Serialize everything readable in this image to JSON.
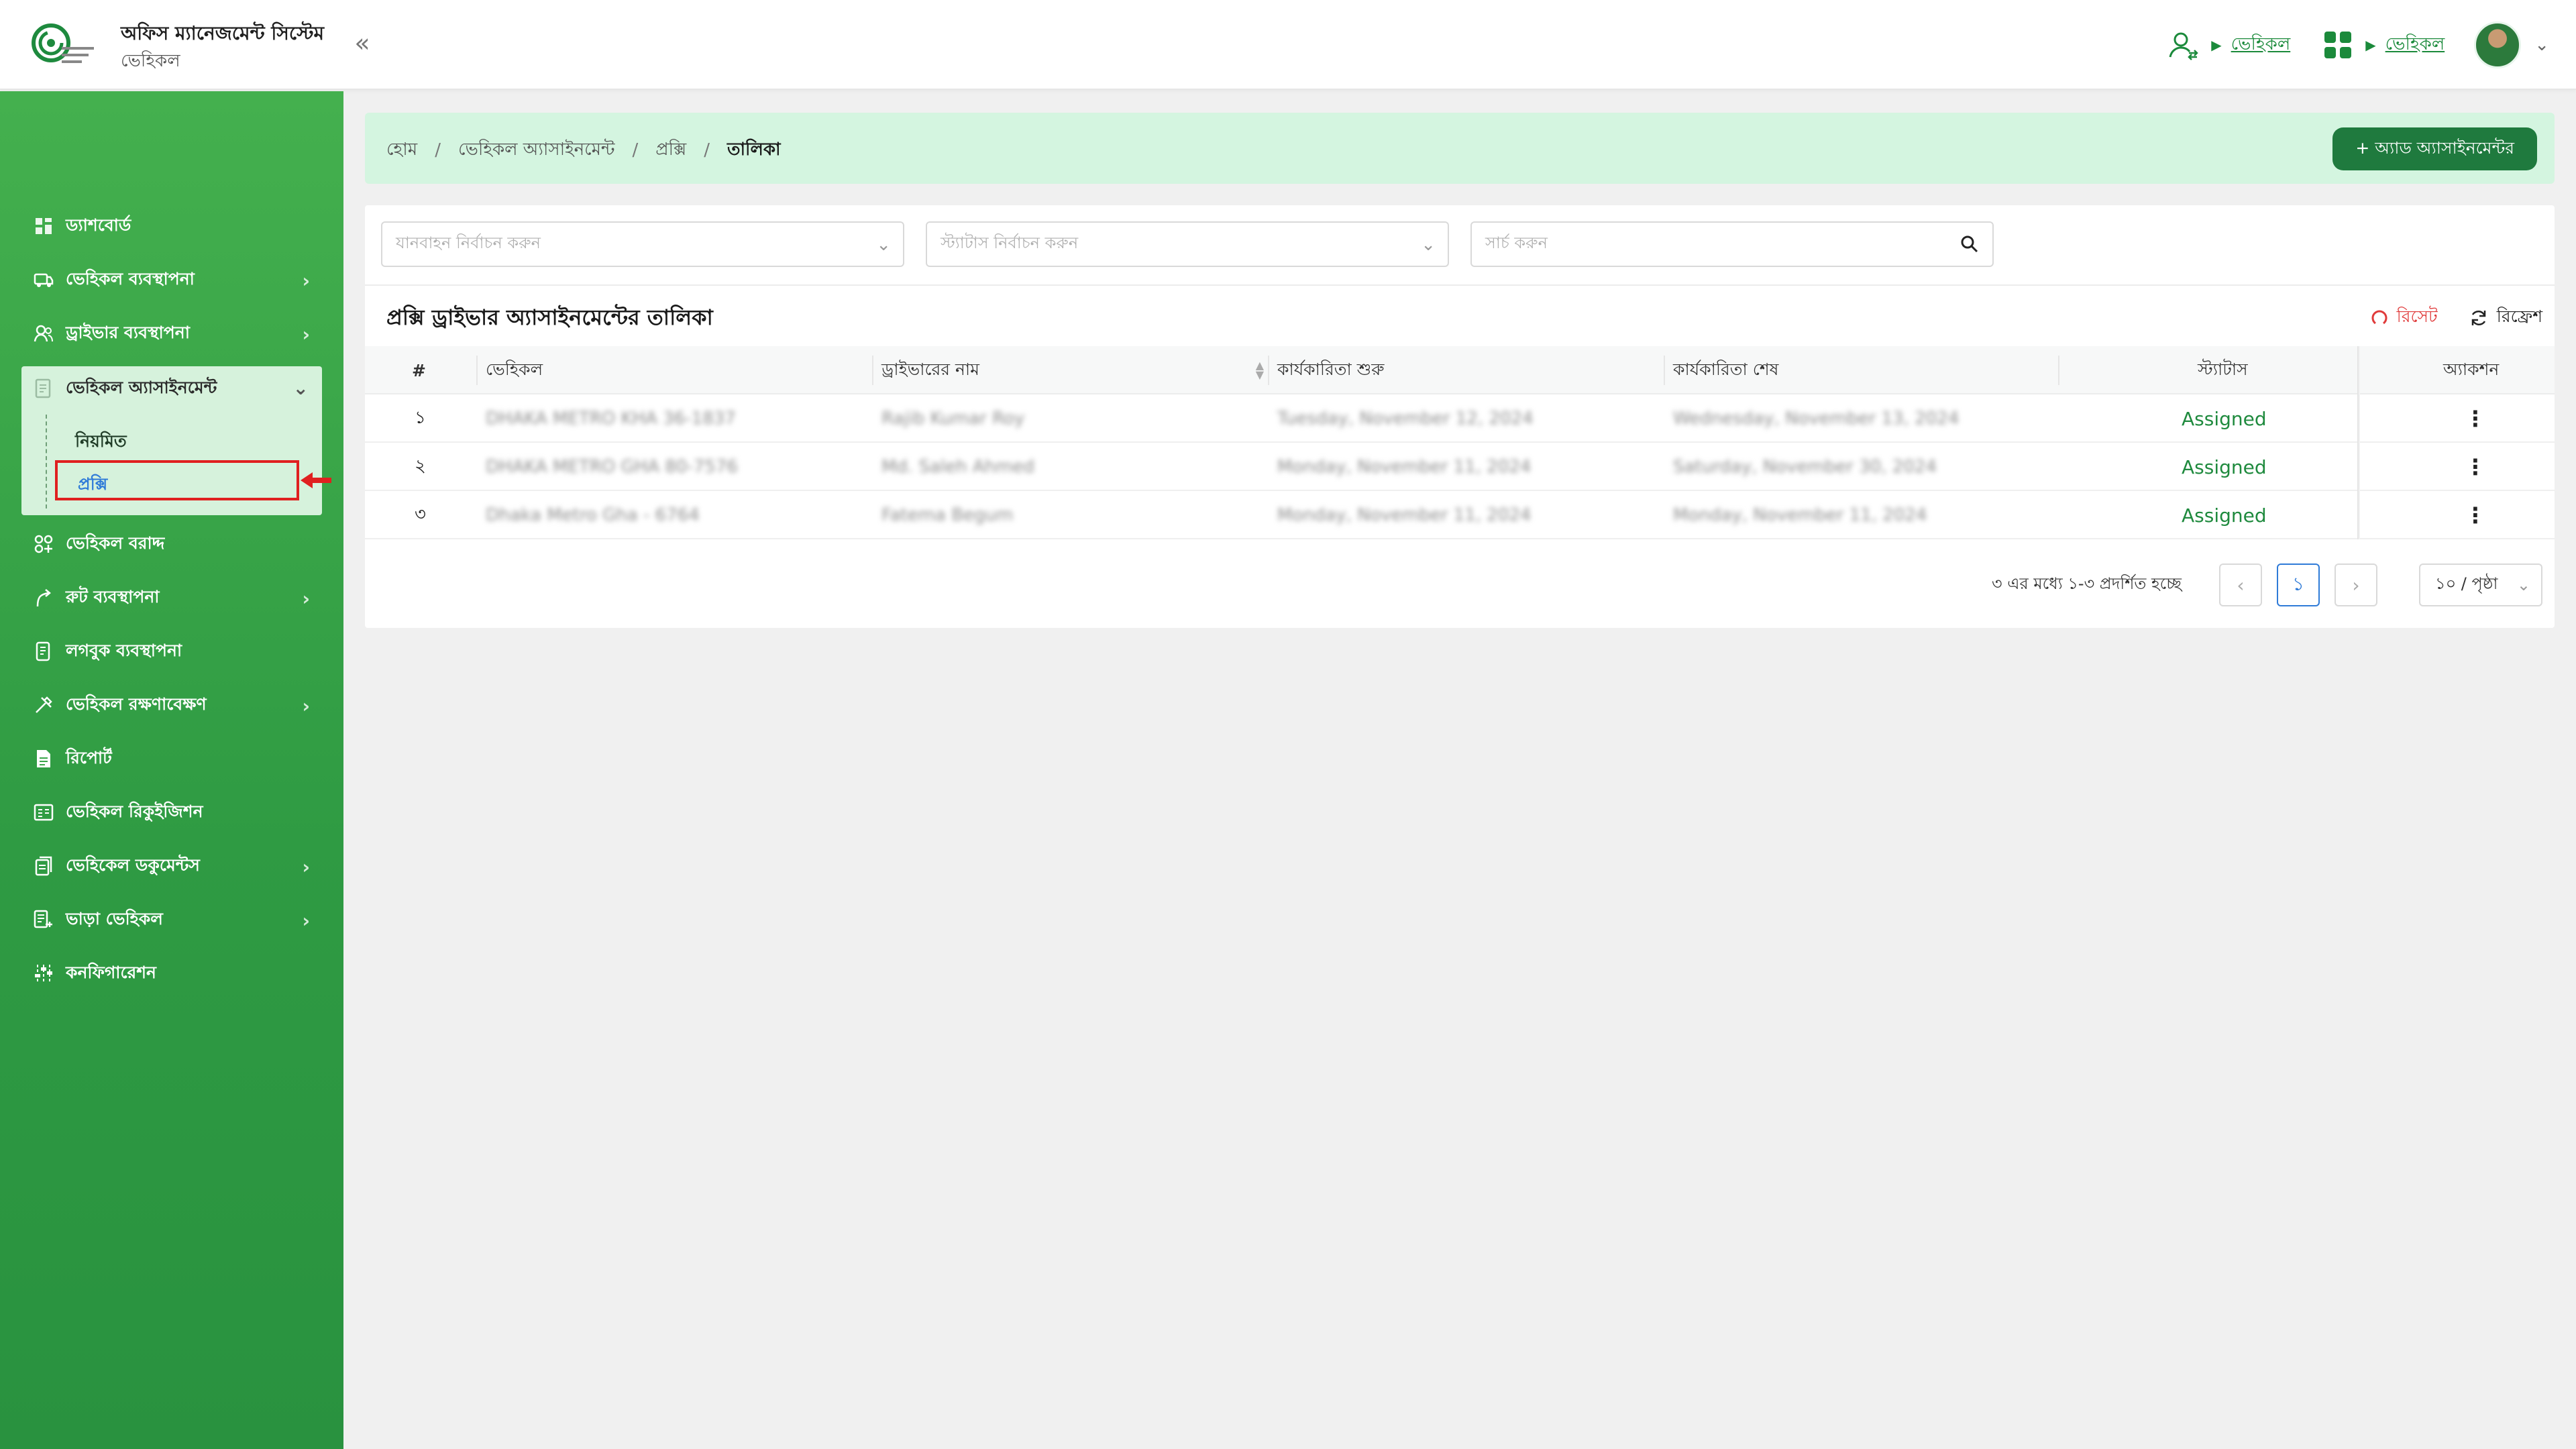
{
  "app": {
    "title": "অফিস ম্যানেজমেন্ট সিস্টেম",
    "subtitle": "ভেহিকল"
  },
  "header": {
    "link1": "ভেহিকল",
    "link2": "ভেহিকল",
    "collapse_icon": "«"
  },
  "sidebar": {
    "items": [
      {
        "label": "ড্যাশবোর্ড",
        "icon": "dashboard-icon"
      },
      {
        "label": "ভেহিকল ব্যবস্থাপনা",
        "icon": "car-icon"
      },
      {
        "label": "ড্রাইভার ব্যবস্থাপনা",
        "icon": "users-icon"
      },
      {
        "label": "ভেহিকল অ্যাসাইনমেন্ট",
        "icon": "document-icon"
      },
      {
        "label": "ভেহিকল বরাদ্দ",
        "icon": "grid-plus-icon"
      },
      {
        "label": "রুট ব্যবস্থাপনা",
        "icon": "route-icon"
      },
      {
        "label": "লগবুক ব্যবস্থাপনা",
        "icon": "logbook-icon"
      },
      {
        "label": "ভেহিকল রক্ষণাবেক্ষণ",
        "icon": "tools-icon"
      },
      {
        "label": "রিপোর্ট",
        "icon": "report-icon"
      },
      {
        "label": "ভেহিকল রিকুইজিশন",
        "icon": "requisition-icon"
      },
      {
        "label": "ভেহিকেল ডকুমেন্টস",
        "icon": "documents-icon"
      },
      {
        "label": "ভাড়া ভেহিকল",
        "icon": "rent-icon"
      },
      {
        "label": "কনফিগারেশন",
        "icon": "sliders-icon"
      }
    ],
    "assignment_sub": {
      "regular": "নিয়মিত",
      "proxy": "প্রক্সি"
    }
  },
  "breadcrumb": {
    "items": [
      "হোম",
      "ভেহিকল অ্যাসাইনমেন্ট",
      "প্রক্সি",
      "তালিকা"
    ],
    "separator": "/"
  },
  "add_button": "+ অ্যাড অ্যাসাইনমেন্টর",
  "filters": {
    "vehicle_placeholder": "যানবাহন নির্বাচন করুন",
    "status_placeholder": "স্ট্যাটাস নির্বাচন করুন",
    "search_placeholder": "সার্চ করুন"
  },
  "table": {
    "title": "প্রক্সি ড্রাইভার অ্যাসাইনমেন্টের তালিকা",
    "reset": "রিসেট",
    "refresh": "রিফ্রেশ",
    "headers": [
      "#",
      "ভেহিকল",
      "ড্রাইভারের নাম",
      "কার্যকারিতা শুরু",
      "কার্যকারিতা শেষ",
      "স্ট্যাটাস",
      "অ্যাকশন"
    ],
    "rows": [
      {
        "no": "১",
        "vehicle": "DHAKA METRO KHA 36-1837",
        "driver": "Rajib Kumar Roy",
        "start": "Tuesday, November 12, 2024",
        "end": "Wednesday, November 13, 2024",
        "status": "Assigned"
      },
      {
        "no": "২",
        "vehicle": "DHAKA METRO GHA 80-7576",
        "driver": "Md. Saleh Ahmed",
        "start": "Monday, November 11, 2024",
        "end": "Saturday, November 30, 2024",
        "status": "Assigned"
      },
      {
        "no": "৩",
        "vehicle": "Dhaka Metro Gha - 6764",
        "driver": "Fatema Begum",
        "start": "Monday, November 11, 2024",
        "end": "Monday, November 11, 2024",
        "status": "Assigned"
      }
    ]
  },
  "pagination": {
    "summary": "৩ এর মধ্যে ১-৩ প্রদর্শিত হচ্ছে",
    "current_page": "১",
    "page_size": "১০ / পৃষ্ঠা"
  },
  "colors": {
    "sidebar": "#3aa64a",
    "accent": "#1f7a3e",
    "status": "#1f8a3e",
    "highlight": "#e02020"
  }
}
